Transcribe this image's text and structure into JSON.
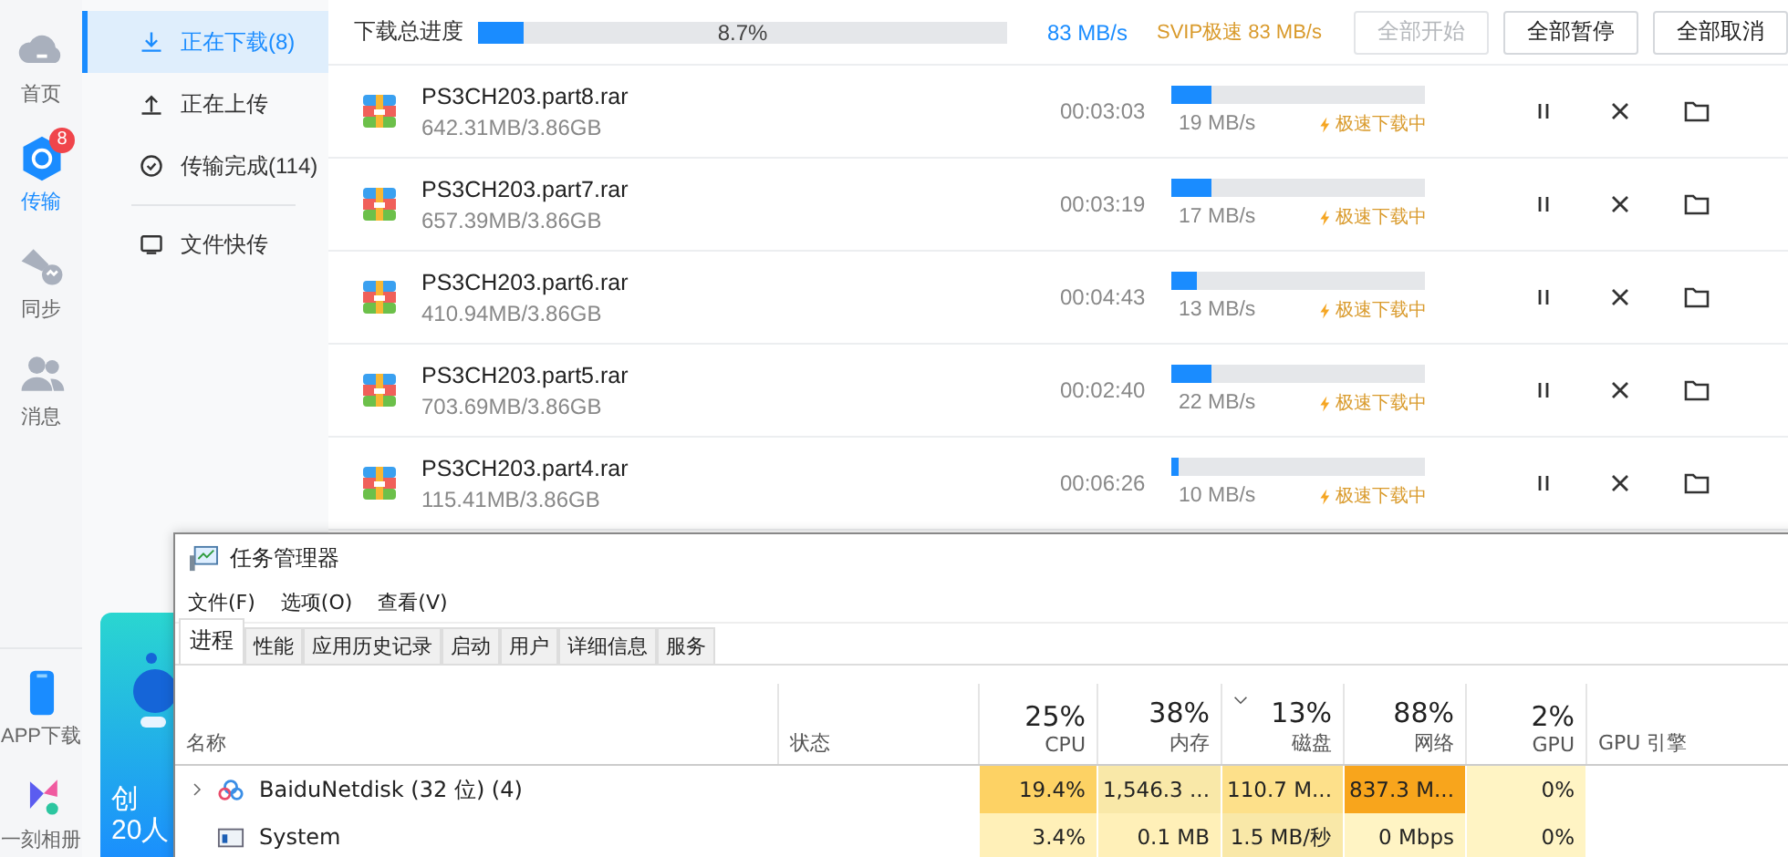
{
  "rail": {
    "top": [
      {
        "label": "首页",
        "kind": "home",
        "selected": false
      },
      {
        "label": "传输",
        "kind": "transfer",
        "selected": true,
        "badge": "8"
      },
      {
        "label": "同步",
        "kind": "sync",
        "selected": false
      },
      {
        "label": "消息",
        "kind": "message",
        "selected": false
      }
    ],
    "bottom": [
      {
        "label": "APP下载",
        "kind": "phone"
      },
      {
        "label": "一刻相册",
        "kind": "album"
      }
    ]
  },
  "nav": [
    {
      "label": "正在下载(8)",
      "kind": "download",
      "selected": true
    },
    {
      "label": "正在上传",
      "kind": "upload",
      "selected": false
    },
    {
      "label": "传输完成(114)",
      "kind": "done",
      "selected": false
    },
    {
      "label": "文件快传",
      "kind": "quick",
      "selected": false
    }
  ],
  "promo": {
    "lines": [
      "创",
      "20人"
    ]
  },
  "toolbar": {
    "label": "下载总进度",
    "level": 0.087,
    "percent": "8.7%",
    "speed": "83 MB/s",
    "svip": "SVIP极速 83 MB/s",
    "buttons": [
      {
        "label": "全部开始",
        "disabled": true
      },
      {
        "label": "全部暂停",
        "disabled": false
      },
      {
        "label": "全部取消",
        "disabled": false
      }
    ]
  },
  "downloads": [
    {
      "name": "PS3CH203.part8.rar",
      "size": "642.31MB/3.86GB",
      "time": "00:03:03",
      "level": 0.16,
      "speed": "19 MB/s",
      "status": "极速下载中"
    },
    {
      "name": "PS3CH203.part7.rar",
      "size": "657.39MB/3.86GB",
      "time": "00:03:19",
      "level": 0.16,
      "speed": "17 MB/s",
      "status": "极速下载中"
    },
    {
      "name": "PS3CH203.part6.rar",
      "size": "410.94MB/3.86GB",
      "time": "00:04:43",
      "level": 0.1,
      "speed": "13 MB/s",
      "status": "极速下载中"
    },
    {
      "name": "PS3CH203.part5.rar",
      "size": "703.69MB/3.86GB",
      "time": "00:02:40",
      "level": 0.16,
      "speed": "22 MB/s",
      "status": "极速下载中"
    },
    {
      "name": "PS3CH203.part4.rar",
      "size": "115.41MB/3.86GB",
      "time": "00:06:26",
      "level": 0.03,
      "speed": "10 MB/s",
      "status": "极速下载中"
    }
  ],
  "task_manager": {
    "title": "任务管理器",
    "menu": [
      "文件(F)",
      "选项(O)",
      "查看(V)"
    ],
    "tabs": [
      {
        "label": "进程",
        "selected": true
      },
      {
        "label": "性能",
        "selected": false
      },
      {
        "label": "应用历史记录",
        "selected": false
      },
      {
        "label": "启动",
        "selected": false
      },
      {
        "label": "用户",
        "selected": false
      },
      {
        "label": "详细信息",
        "selected": false
      },
      {
        "label": "服务",
        "selected": false
      }
    ],
    "columns": [
      {
        "label": "名称"
      },
      {
        "label": "状态"
      },
      {
        "label": "CPU",
        "percent": "25%"
      },
      {
        "label": "内存",
        "percent": "38%"
      },
      {
        "label": "磁盘",
        "percent": "13%",
        "sorted": true
      },
      {
        "label": "网络",
        "percent": "88%"
      },
      {
        "label": "GPU",
        "percent": "2%"
      },
      {
        "label": "GPU 引擎"
      }
    ],
    "rows": [
      {
        "kind": "app",
        "expanded": false,
        "cells": [
          {
            "text": "BaiduNetdisk (32 位) (4)"
          },
          {
            "text": ""
          },
          {
            "text": "19.4%",
            "color": "#fdd264"
          },
          {
            "text": "1,546.3 ...",
            "color": "#f9e8a8"
          },
          {
            "text": "110.7 M...",
            "color": "#fde08a"
          },
          {
            "text": "837.3 M...",
            "color": "#f8a51c"
          },
          {
            "text": "0%",
            "color": "#fff4c4"
          }
        ]
      },
      {
        "kind": "system",
        "cells": [
          {
            "text": "System"
          },
          {
            "text": ""
          },
          {
            "text": "3.4%",
            "color": "#fff0b8"
          },
          {
            "text": "0.1 MB",
            "color": "#fff0b8"
          },
          {
            "text": "1.5 MB/秒",
            "color": "#f9e8a8"
          },
          {
            "text": "0 Mbps",
            "color": "#fff4c4"
          },
          {
            "text": "0%",
            "color": "#fff4c4"
          }
        ]
      }
    ]
  }
}
